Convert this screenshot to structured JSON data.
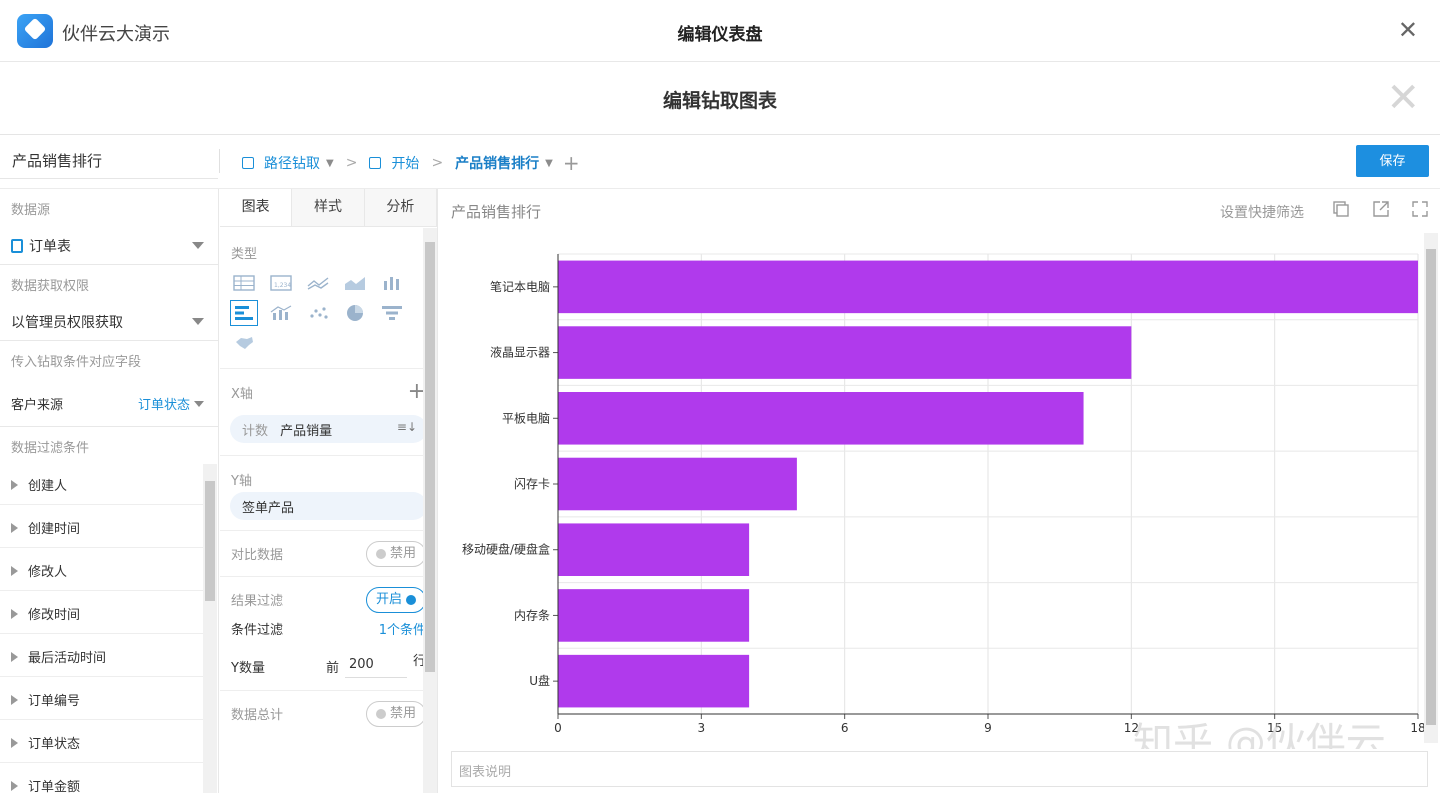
{
  "topbar": {
    "app_name": "伙伴云大演示",
    "title": "编辑仪表盘"
  },
  "dialog": {
    "title": "编辑钻取图表"
  },
  "toolbar": {
    "chart_name": "产品销售排行",
    "crumbs": {
      "drill": "路径钻取",
      "start": "开始",
      "current": "产品销售排行"
    },
    "save_label": "保存"
  },
  "left_panel": {
    "datasource_label": "数据源",
    "datasource_value": "订单表",
    "permission_label": "数据获取权限",
    "permission_value": "以管理员权限获取",
    "drill_field_label": "传入钻取条件对应字段",
    "mapping_source": "客户来源",
    "mapping_target": "订单状态",
    "filter_label": "数据过滤条件",
    "filters": [
      "创建人",
      "创建时间",
      "修改人",
      "修改时间",
      "最后活动时间",
      "订单编号",
      "订单状态",
      "订单金额"
    ]
  },
  "settings_panel": {
    "tabs": [
      "图表",
      "样式",
      "分析"
    ],
    "type_label": "类型",
    "x_axis_label": "X轴",
    "x_axis_count": "计数",
    "x_axis_field": "产品销量",
    "y_axis_label": "Y轴",
    "y_axis_field": "签单产品",
    "compare_label": "对比数据",
    "compare_state": "禁用",
    "result_filter_label": "结果过滤",
    "result_filter_state": "开启",
    "cond_filter_label": "条件过滤",
    "cond_filter_value": "1个条件",
    "y_count_label": "Y数量",
    "y_count_prefix": "前",
    "y_count_value": "200",
    "y_count_suffix": "行",
    "total_label": "数据总计",
    "total_state": "禁用"
  },
  "chart_panel": {
    "title": "产品销售排行",
    "quick_filter": "设置快捷筛选",
    "description_placeholder": "图表说明"
  },
  "watermark": "知乎 @伙伴云",
  "colors": {
    "bar": "#b03aec",
    "accent": "#1a8fd8"
  },
  "chart_data": {
    "type": "bar",
    "orientation": "horizontal",
    "title": "",
    "categories": [
      "笔记本电脑",
      "液晶显示器",
      "平板电脑",
      "闪存卡",
      "移动硬盘/硬盘盒",
      "内存条",
      "U盘"
    ],
    "values": [
      18,
      12,
      11,
      5,
      4,
      4,
      4
    ],
    "xlim": [
      0,
      18
    ],
    "xticks": [
      0,
      3,
      6,
      9,
      12,
      15,
      18
    ],
    "grid": true,
    "legend": "none"
  }
}
